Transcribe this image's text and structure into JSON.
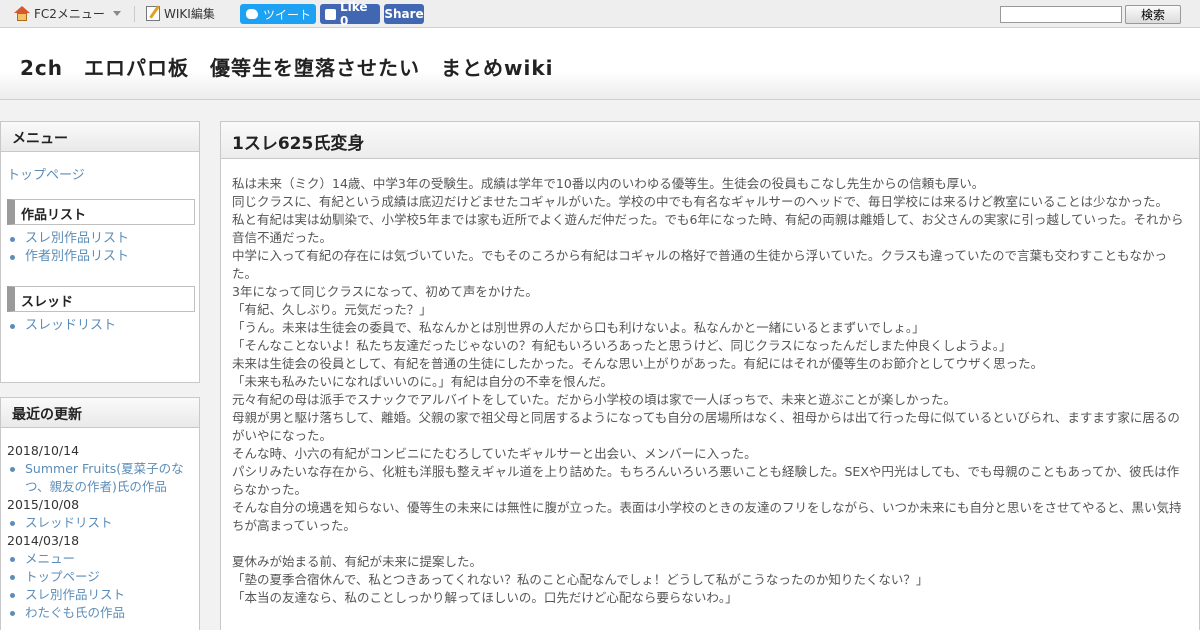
{
  "topbar": {
    "fc2_menu_label": "FC2メニュー",
    "wiki_edit_label": "WIKI編集",
    "tweet_label": "ツイート",
    "like_label": "Like 0",
    "share_label": "Share",
    "search_value": "",
    "search_button_label": "検索"
  },
  "header": {
    "site_title": "2ch　エロパロ板　優等生を堕落させたい　まとめwiki"
  },
  "sidebar": {
    "menu_title": "メニュー",
    "top_page": "トップページ",
    "works_heading": "作品リスト",
    "works_items": [
      "スレ別作品リスト",
      "作者別作品リスト"
    ],
    "thread_heading": "スレッド",
    "thread_items": [
      "スレッドリスト"
    ],
    "recent_title": "最近の更新",
    "recent": [
      {
        "date": "2018/10/14",
        "items": [
          "Summer Fruits(夏菜子のなつ、親友の作者)氏の作品"
        ]
      },
      {
        "date": "2015/10/08",
        "items": [
          "スレッドリスト"
        ]
      },
      {
        "date": "2014/03/18",
        "items": [
          "メニュー",
          "トップページ",
          "スレ別作品リスト",
          "わたぐも氏の作品"
        ]
      }
    ]
  },
  "main": {
    "title": "1スレ625氏変身",
    "paragraphs": [
      "私は未来（ミク）14歳、中学3年の受験生。成績は学年で10番以内のいわゆる優等生。生徒会の役員もこなし先生からの信頼も厚い。",
      "同じクラスに、有紀という成績は底辺だけどませたコギャルがいた。学校の中でも有名なギャルサーのヘッドで、毎日学校には来るけど教室にいることは少なかった。",
      "私と有紀は実は幼馴染で、小学校5年までは家も近所でよく遊んだ仲だった。でも6年になった時、有紀の両親は離婚して、お父さんの実家に引っ越していった。それから音信不通だった。",
      "中学に入って有紀の存在には気づいていた。でもそのころから有紀はコギャルの格好で普通の生徒から浮いていた。クラスも違っていたので言葉も交わすこともなかった。",
      "3年になって同じクラスになって、初めて声をかけた。",
      "「有紀、久しぶり。元気だった？」",
      "「うん。未来は生徒会の委員で、私なんかとは別世界の人だから口も利けないよ。私なんかと一緒にいるとまずいでしょ。」",
      "「そんなことないよ！私たち友達だったじゃないの？有紀もいろいろあったと思うけど、同じクラスになったんだしまた仲良くしようよ。」",
      "未来は生徒会の役員として、有紀を普通の生徒にしたかった。そんな思い上がりがあった。有紀にはそれが優等生のお節介としてウザく思った。",
      "「未来も私みたいになればいいのに。」有紀は自分の不幸を恨んだ。",
      "元々有紀の母は派手でスナックでアルバイトをしていた。だから小学校の頃は家で一人ぼっちで、未来と遊ぶことが楽しかった。",
      "母親が男と駆け落ちして、離婚。父親の家で祖父母と同居するようになっても自分の居場所はなく、祖母からは出て行った母に似ているといびられ、ますます家に居るのがいやになった。",
      "そんな時、小六の有紀がコンビニにたむろしていたギャルサーと出会い、メンバーに入った。",
      "パシリみたいな存在から、化粧も洋服も整えギャル道を上り詰めた。もちろんいろいろ悪いことも経験した。SEXや円光はしても、でも母親のこともあってか、彼氏は作らなかった。",
      "そんな自分の境遇を知らない、優等生の未来には無性に腹が立った。表面は小学校のときの友達のフリをしながら、いつか未来にも自分と思いをさせてやると、黒い気持ちが高まっていった。",
      "",
      "夏休みが始まる前、有紀が未来に提案した。",
      "「塾の夏季合宿休んで、私とつきあってくれない？私のこと心配なんでしょ！どうして私がこうなったのか知りたくない？」",
      "「本当の友達なら、私のことしっかり解ってほしいの。口先だけど心配なら要らないわ。」"
    ]
  }
}
